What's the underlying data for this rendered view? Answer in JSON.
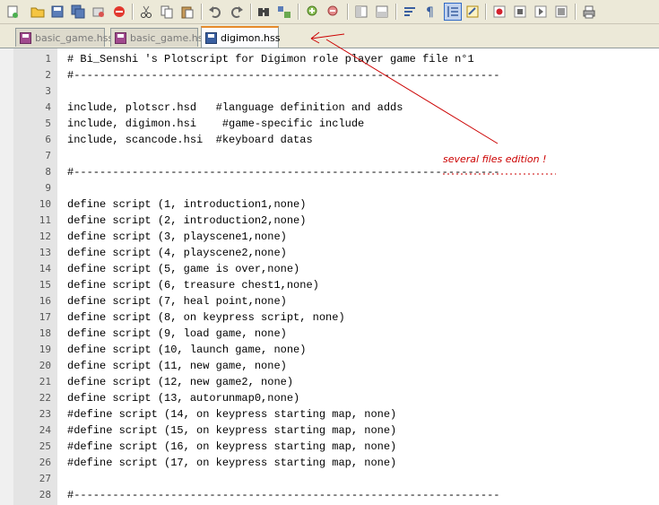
{
  "toolbar": {
    "icons": [
      "new-file",
      "open-file",
      "save",
      "save-all",
      "close",
      "close-all",
      "cut",
      "copy",
      "paste",
      "undo",
      "redo",
      "find",
      "replace",
      "zoom-in",
      "zoom-out",
      "wrap",
      "sync",
      "indent",
      "show-all",
      "guide",
      "guide2",
      "record",
      "stop",
      "play",
      "save-macro",
      "print"
    ]
  },
  "tabs": [
    {
      "label": "basic_game.hss",
      "active": false
    },
    {
      "label": "basic_game.hsi",
      "active": false
    },
    {
      "label": "digimon.hss",
      "active": true
    }
  ],
  "editor": {
    "lines": [
      {
        "n": "1",
        "text": "# Bi_Senshi 's Plotscript for Digimon role player game file n°1"
      },
      {
        "n": "2",
        "text": "#------------------------------------------------------------------"
      },
      {
        "n": "3",
        "text": ""
      },
      {
        "n": "4",
        "text": "include, plotscr.hsd   #language definition and adds"
      },
      {
        "n": "5",
        "text": "include, digimon.hsi    #game-specific include"
      },
      {
        "n": "6",
        "text": "include, scancode.hsi  #keyboard datas"
      },
      {
        "n": "7",
        "text": ""
      },
      {
        "n": "8",
        "text": "#------------------------------------------------------------------"
      },
      {
        "n": "9",
        "text": ""
      },
      {
        "n": "10",
        "text": "define script (1, introduction1,none)"
      },
      {
        "n": "11",
        "text": "define script (2, introduction2,none)"
      },
      {
        "n": "12",
        "text": "define script (3, playscene1,none)"
      },
      {
        "n": "13",
        "text": "define script (4, playscene2,none)"
      },
      {
        "n": "14",
        "text": "define script (5, game is over,none)"
      },
      {
        "n": "15",
        "text": "define script (6, treasure chest1,none)"
      },
      {
        "n": "16",
        "text": "define script (7, heal point,none)"
      },
      {
        "n": "17",
        "text": "define script (8, on keypress script, none)"
      },
      {
        "n": "18",
        "text": "define script (9, load game, none)"
      },
      {
        "n": "19",
        "text": "define script (10, launch game, none)"
      },
      {
        "n": "20",
        "text": "define script (11, new game, none)"
      },
      {
        "n": "21",
        "text": "define script (12, new game2, none)"
      },
      {
        "n": "22",
        "text": "define script (13, autorunmap0,none)"
      },
      {
        "n": "23",
        "text": "#define script (14, on keypress starting map, none)"
      },
      {
        "n": "24",
        "text": "#define script (15, on keypress starting map, none)"
      },
      {
        "n": "25",
        "text": "#define script (16, on keypress starting map, none)"
      },
      {
        "n": "26",
        "text": "#define script (17, on keypress starting map, none)"
      },
      {
        "n": "27",
        "text": ""
      },
      {
        "n": "28",
        "text": "#------------------------------------------------------------------"
      }
    ]
  },
  "annotation": {
    "text": "several files edition !",
    "color": "#cc0000"
  }
}
